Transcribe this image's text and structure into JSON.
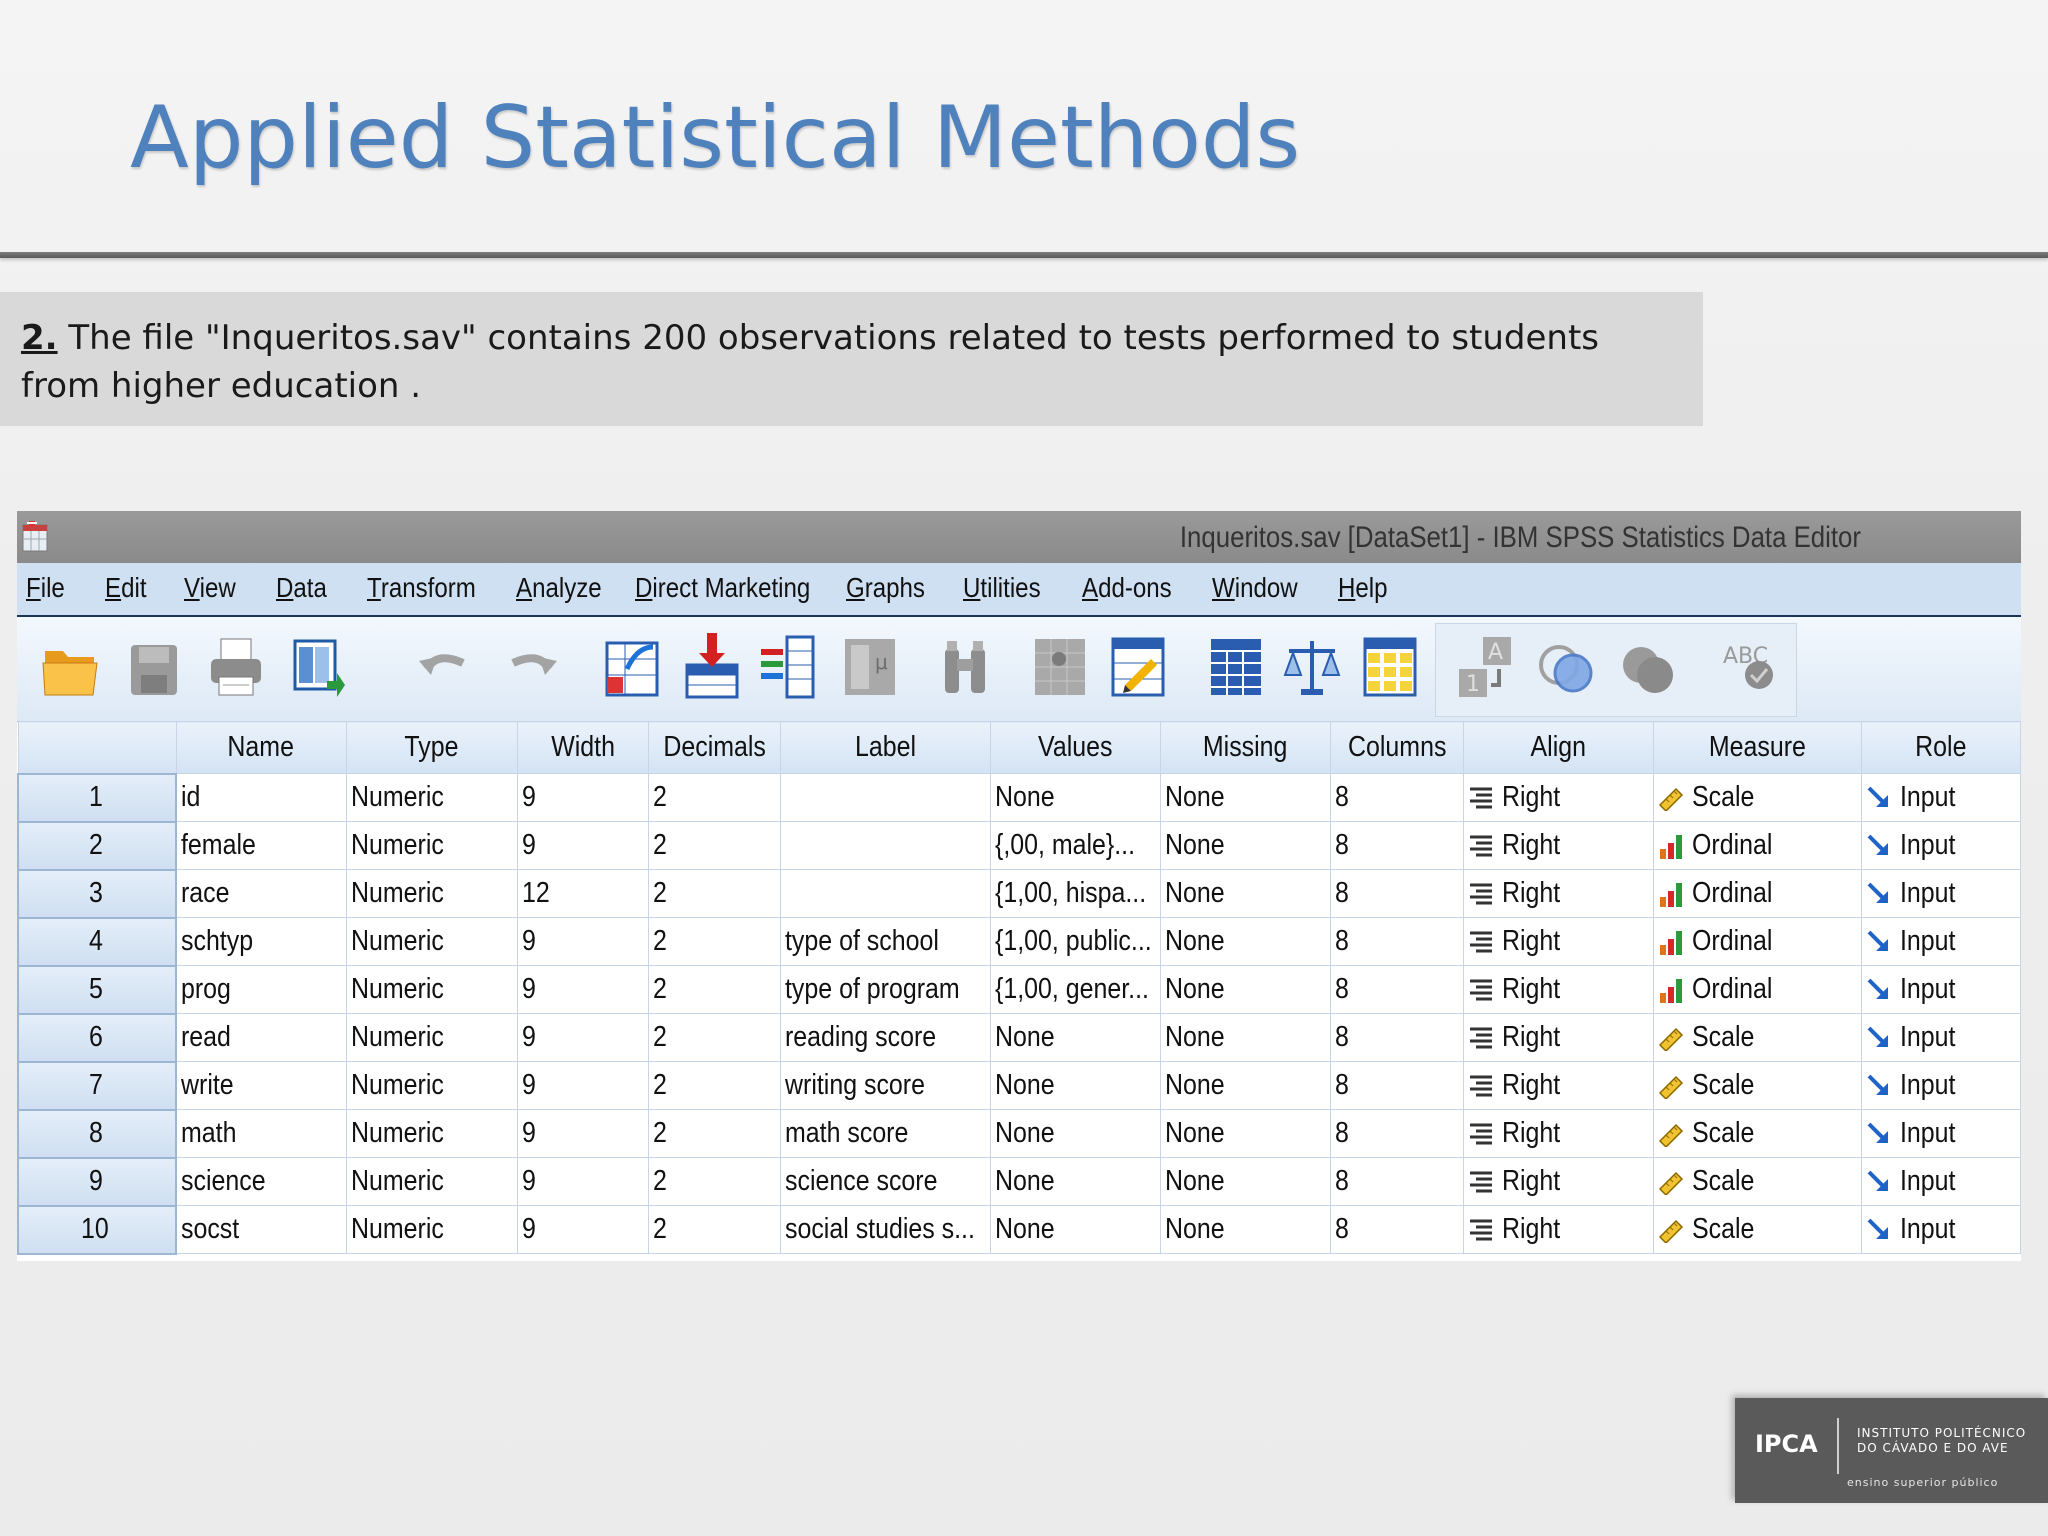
{
  "slide": {
    "title": "Applied Statistical Methods",
    "question_number": "2.",
    "question_text": " The file \"Inqueritos.sav\" contains 200 observations related to tests performed to students from higher education ."
  },
  "window": {
    "title": "Inqueritos.sav [DataSet1] - IBM SPSS Statistics Data Editor"
  },
  "menu": [
    "File",
    "Edit",
    "View",
    "Data",
    "Transform",
    "Analyze",
    "Direct Marketing",
    "Graphs",
    "Utilities",
    "Add-ons",
    "Window",
    "Help"
  ],
  "toolbar_icons": [
    "open-folder-icon",
    "save-icon",
    "print-icon",
    "recall-dialog-icon",
    "undo-icon",
    "redo-icon",
    "goto-case-icon",
    "insert-cases-icon",
    "insert-variable-icon",
    "split-file-icon",
    "find-icon",
    "select-cases-icon",
    "value-labels-icon",
    "use-variable-sets-icon",
    "weight-cases-icon",
    "show-all-variables-icon",
    "custom-attributes-icon",
    "circles-icon",
    "filled-circles-icon",
    "spell-check-icon"
  ],
  "columns": [
    "Name",
    "Type",
    "Width",
    "Decimals",
    "Label",
    "Values",
    "Missing",
    "Columns",
    "Align",
    "Measure",
    "Role"
  ],
  "rows": [
    {
      "n": "1",
      "name": "id",
      "type": "Numeric",
      "width": "9",
      "decimals": "2",
      "label": "",
      "values": "None",
      "missing": "None",
      "columns": "8",
      "align": "Right",
      "measure": "Scale",
      "role": "Input"
    },
    {
      "n": "2",
      "name": "female",
      "type": "Numeric",
      "width": "9",
      "decimals": "2",
      "label": "",
      "values": "{,00, male}...",
      "missing": "None",
      "columns": "8",
      "align": "Right",
      "measure": "Ordinal",
      "role": "Input"
    },
    {
      "n": "3",
      "name": "race",
      "type": "Numeric",
      "width": "12",
      "decimals": "2",
      "label": "",
      "values": "{1,00, hispa...",
      "missing": "None",
      "columns": "8",
      "align": "Right",
      "measure": "Ordinal",
      "role": "Input"
    },
    {
      "n": "4",
      "name": "schtyp",
      "type": "Numeric",
      "width": "9",
      "decimals": "2",
      "label": "type of school",
      "values": "{1,00, public...",
      "missing": "None",
      "columns": "8",
      "align": "Right",
      "measure": "Ordinal",
      "role": "Input"
    },
    {
      "n": "5",
      "name": "prog",
      "type": "Numeric",
      "width": "9",
      "decimals": "2",
      "label": "type of program",
      "values": "{1,00, gener...",
      "missing": "None",
      "columns": "8",
      "align": "Right",
      "measure": "Ordinal",
      "role": "Input"
    },
    {
      "n": "6",
      "name": "read",
      "type": "Numeric",
      "width": "9",
      "decimals": "2",
      "label": "reading score",
      "values": "None",
      "missing": "None",
      "columns": "8",
      "align": "Right",
      "measure": "Scale",
      "role": "Input"
    },
    {
      "n": "7",
      "name": "write",
      "type": "Numeric",
      "width": "9",
      "decimals": "2",
      "label": "writing score",
      "values": "None",
      "missing": "None",
      "columns": "8",
      "align": "Right",
      "measure": "Scale",
      "role": "Input"
    },
    {
      "n": "8",
      "name": "math",
      "type": "Numeric",
      "width": "9",
      "decimals": "2",
      "label": "math score",
      "values": "None",
      "missing": "None",
      "columns": "8",
      "align": "Right",
      "measure": "Scale",
      "role": "Input"
    },
    {
      "n": "9",
      "name": "science",
      "type": "Numeric",
      "width": "9",
      "decimals": "2",
      "label": "science score",
      "values": "None",
      "missing": "None",
      "columns": "8",
      "align": "Right",
      "measure": "Scale",
      "role": "Input"
    },
    {
      "n": "10",
      "name": "socst",
      "type": "Numeric",
      "width": "9",
      "decimals": "2",
      "label": "social studies s...",
      "values": "None",
      "missing": "None",
      "columns": "8",
      "align": "Right",
      "measure": "Scale",
      "role": "Input"
    }
  ],
  "logo": {
    "mark": "IPCA",
    "name_line1": "INSTITUTO POLITÉCNICO",
    "name_line2": "DO CÁVADO E DO AVE",
    "tagline": "ensino superior público"
  },
  "colors": {
    "title": "#4f81bd",
    "menubar": "#cfe0f3",
    "header": "#d3e3f4"
  }
}
